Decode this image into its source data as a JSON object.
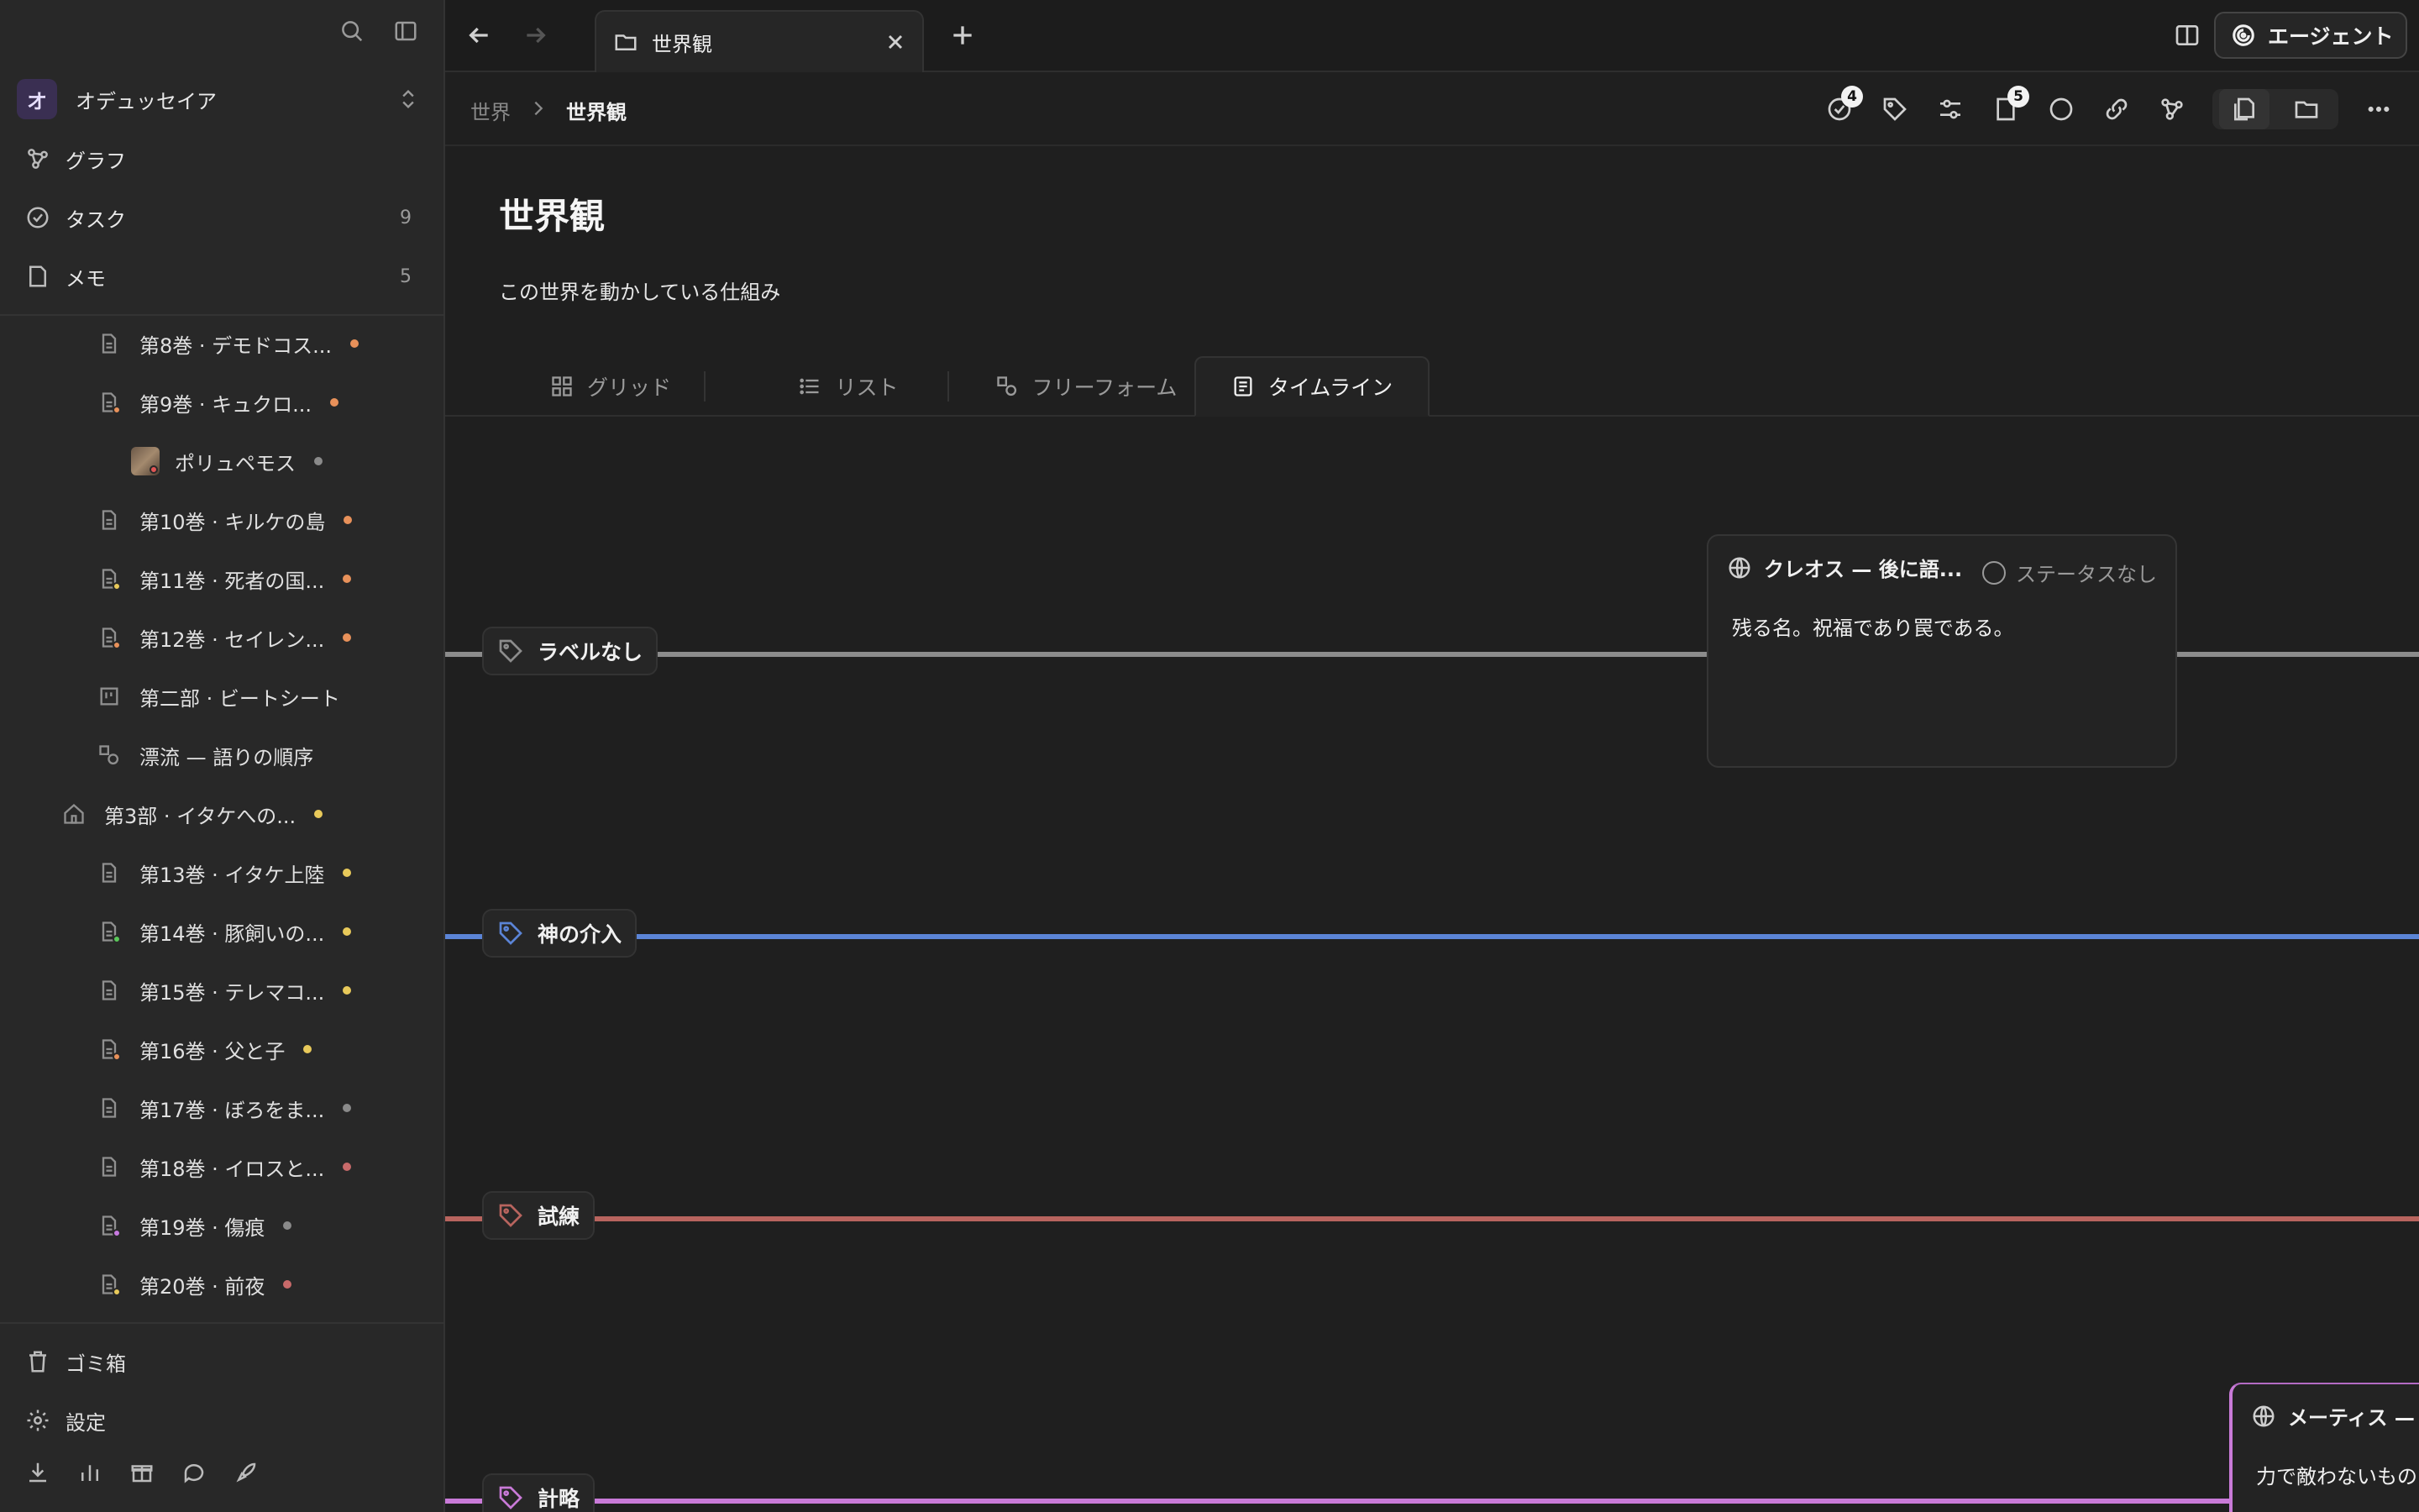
{
  "sidebar": {
    "workspace": {
      "avatar": "オ",
      "name": "オデュッセイア"
    },
    "nav": [
      {
        "label": "グラフ",
        "icon": "graph-icon",
        "count": ""
      },
      {
        "label": "タスク",
        "icon": "task-check-icon",
        "count": "9"
      },
      {
        "label": "メモ",
        "icon": "note-icon",
        "count": "5"
      }
    ],
    "tree": [
      {
        "label": "第8巻 · デモドコス...",
        "icon": "document-icon",
        "dot": "#e8915a",
        "badge": ""
      },
      {
        "label": "第9巻 · キュクロ...",
        "icon": "document-icon",
        "dot": "#e8915a",
        "badge": "#e8915a"
      },
      {
        "label": "ポリュペモス",
        "icon": "image-thumbnail",
        "dot": "#8a8a8a",
        "badge": "#e05555"
      },
      {
        "label": "第10巻 · キルケの島",
        "icon": "document-icon",
        "dot": "#e8915a",
        "badge": ""
      },
      {
        "label": "第11巻 · 死者の国...",
        "icon": "document-icon",
        "dot": "#e8915a",
        "badge": "#e8c95a"
      },
      {
        "label": "第12巻 · セイレン...",
        "icon": "document-icon",
        "dot": "#e8915a",
        "badge": "#e8915a"
      },
      {
        "label": "第二部 · ビートシート",
        "icon": "board-icon",
        "dot": "",
        "badge": ""
      },
      {
        "label": "漂流 — 語りの順序",
        "icon": "freeform-icon",
        "dot": "",
        "badge": ""
      },
      {
        "label": "第3部 · イタケへの...",
        "icon": "home-icon",
        "dot": "#e8c95a",
        "badge": ""
      },
      {
        "label": "第13巻 · イタケ上陸",
        "icon": "document-icon",
        "dot": "#e8c95a",
        "badge": ""
      },
      {
        "label": "第14巻 · 豚飼いの...",
        "icon": "document-icon",
        "dot": "#e8c95a",
        "badge": "#5ac85a"
      },
      {
        "label": "第15巻 · テレマコ...",
        "icon": "document-icon",
        "dot": "#e8c95a",
        "badge": ""
      },
      {
        "label": "第16巻 · 父と子",
        "icon": "document-icon",
        "dot": "#e8c95a",
        "badge": "#e8915a"
      },
      {
        "label": "第17巻 · ぼろをま...",
        "icon": "document-icon",
        "dot": "#8a8a8a",
        "badge": ""
      },
      {
        "label": "第18巻 · イロスと...",
        "icon": "document-icon",
        "dot": "#c86a6a",
        "badge": ""
      },
      {
        "label": "第19巻 · 傷痕",
        "icon": "document-icon",
        "dot": "#8a8a8a",
        "badge": "#c87ae0"
      },
      {
        "label": "第20巻 · 前夜",
        "icon": "document-icon",
        "dot": "#c86a6a",
        "badge": "#e8c95a"
      }
    ],
    "bottom": [
      {
        "label": "ゴミ箱",
        "icon": "trash-icon"
      },
      {
        "label": "設定",
        "icon": "gear-icon"
      }
    ],
    "footer_icons": [
      "download-icon",
      "chart-icon",
      "gift-icon",
      "chat-icon",
      "rocket-icon"
    ]
  },
  "topbar": {
    "tab_title": "世界観",
    "agent_label": "エージェント"
  },
  "breadcrumb": {
    "parent": "世界",
    "current": "世界観"
  },
  "toolbar": {
    "tasks_badge": "4",
    "notes_badge": "5"
  },
  "page": {
    "title": "世界観",
    "description": "この世界を動かしている仕組み"
  },
  "view_tabs": [
    {
      "label": "グリッド",
      "icon": "grid-icon"
    },
    {
      "label": "リスト",
      "icon": "list-icon"
    },
    {
      "label": "フリーフォーム",
      "icon": "freeform-icon"
    },
    {
      "label": "タイムライン",
      "icon": "timeline-icon",
      "active": true
    }
  ],
  "timeline": {
    "lanes": [
      {
        "label": "ラベルなし",
        "color": "#8c8c8c"
      },
      {
        "label": "神の介入",
        "color": "#5b84d6"
      },
      {
        "label": "試練",
        "color": "#b8645e"
      },
      {
        "label": "計略",
        "color": "#c97ad8"
      }
    ],
    "cards": [
      {
        "title": "クレオス — 後に語...",
        "status": "ステータスなし",
        "body": "残る名。祝福であり罠である。"
      },
      {
        "title": "メーティス —",
        "status": "",
        "body": "力で敵わないもの"
      }
    ]
  }
}
